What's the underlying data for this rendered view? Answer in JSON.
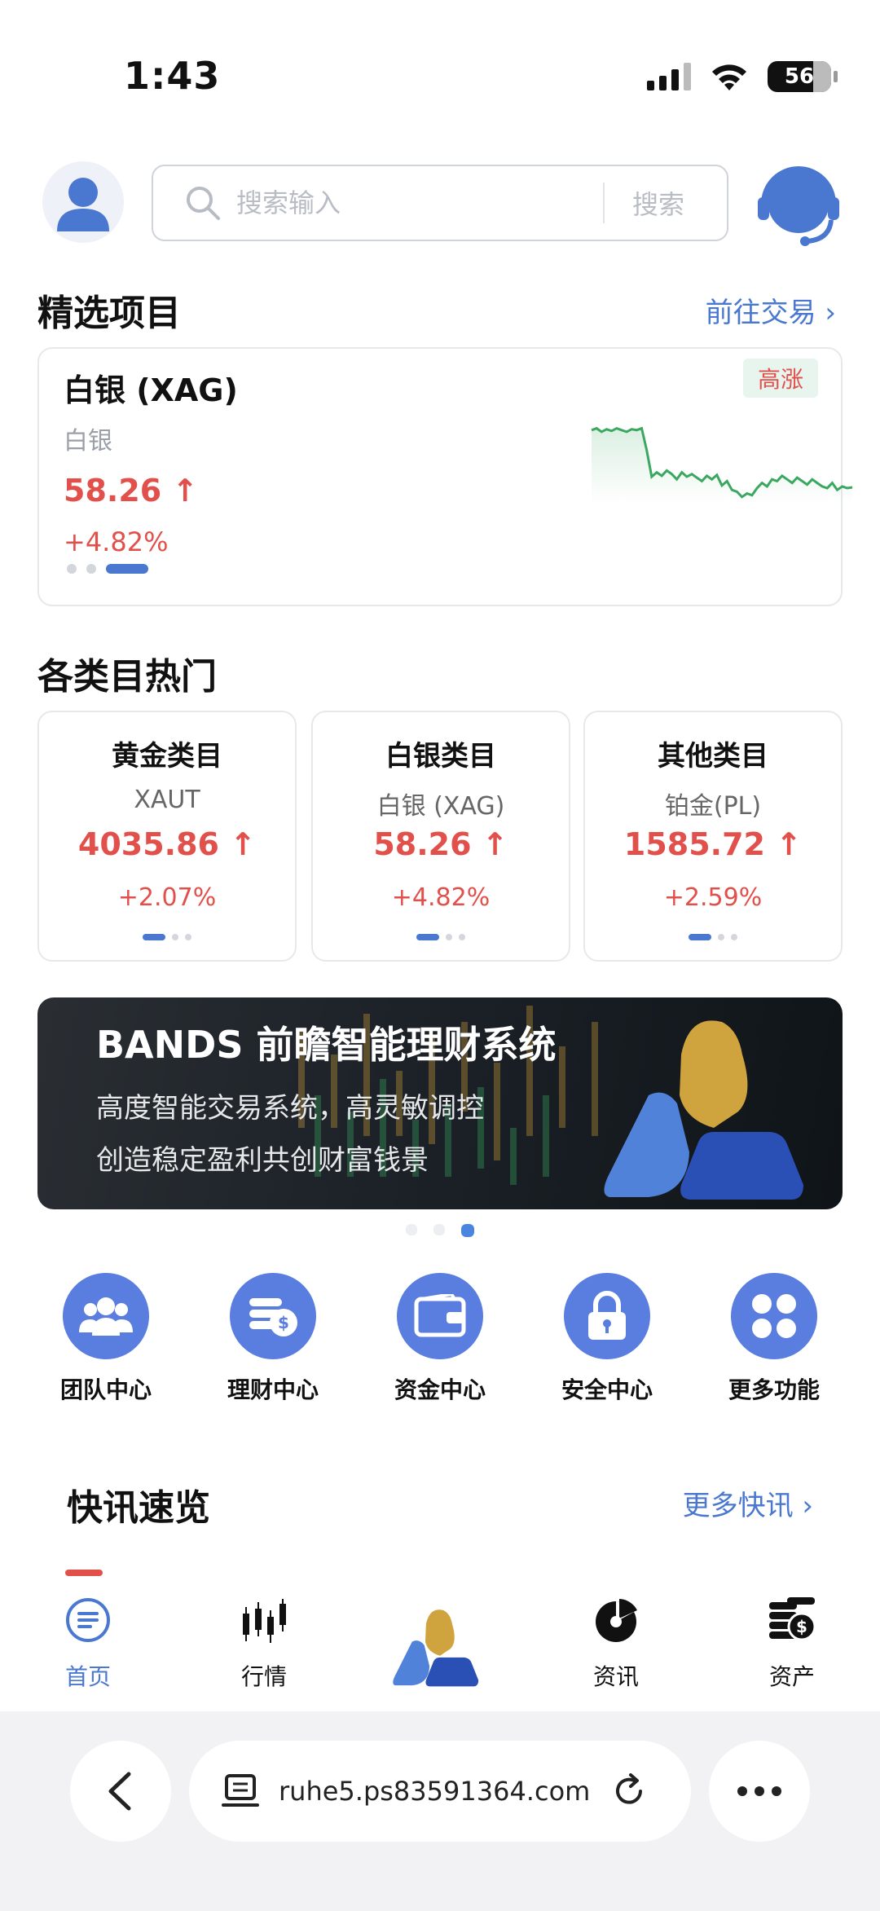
{
  "status_bar": {
    "time": "1:43",
    "battery": "56"
  },
  "header": {
    "search_placeholder": "搜索输入",
    "search_button": "搜索"
  },
  "featured": {
    "title": "精选项目",
    "link": "前往交易 ›",
    "name": "白银 (XAG)",
    "subtitle": "白银",
    "price": "58.26 ↑",
    "change": "+4.82%",
    "badge": "高涨",
    "sparkline": [
      0.78,
      0.8,
      0.76,
      0.79,
      0.77,
      0.8,
      0.78,
      0.76,
      0.79,
      0.78,
      0.8,
      0.55,
      0.25,
      0.3,
      0.26,
      0.32,
      0.28,
      0.22,
      0.3,
      0.25,
      0.28,
      0.24,
      0.2,
      0.26,
      0.22,
      0.27,
      0.15,
      0.2,
      0.1,
      0.08,
      0.02,
      0.06,
      0.04,
      0.12,
      0.18,
      0.14,
      0.22,
      0.2,
      0.26,
      0.22,
      0.18,
      0.24,
      0.2,
      0.16,
      0.22,
      0.18,
      0.14,
      0.12,
      0.18,
      0.1,
      0.14,
      0.12,
      0.13
    ]
  },
  "categories": {
    "title": "各类目热门",
    "items": [
      {
        "title": "黄金类目",
        "sub": "XAUT",
        "price": "4035.86 ↑",
        "change": "+2.07%"
      },
      {
        "title": "白银类目",
        "sub": "白银 (XAG)",
        "price": "58.26 ↑",
        "change": "+4.82%"
      },
      {
        "title": "其他类目",
        "sub": "铂金(PL)",
        "price": "1585.72 ↑",
        "change": "+2.59%"
      }
    ]
  },
  "banner": {
    "title": "BANDS 前瞻智能理财系统",
    "line1": "高度智能交易系统，高灵敏调控",
    "line2": "创造稳定盈利共创财富钱景"
  },
  "functions": [
    {
      "label": "团队中心",
      "icon": "team-icon"
    },
    {
      "label": "理财中心",
      "icon": "coins-icon"
    },
    {
      "label": "资金中心",
      "icon": "wallet-icon"
    },
    {
      "label": "安全中心",
      "icon": "lock-icon"
    },
    {
      "label": "更多功能",
      "icon": "grid-icon"
    }
  ],
  "news": {
    "title": "快讯速览",
    "link": "更多快讯 ›"
  },
  "tabbar": [
    {
      "label": "首页",
      "icon": "home-icon"
    },
    {
      "label": "行情",
      "icon": "candlestick-icon"
    },
    {
      "label": "",
      "icon": "logo-icon"
    },
    {
      "label": "资讯",
      "icon": "pie-icon"
    },
    {
      "label": "资产",
      "icon": "coin-stack-icon"
    }
  ],
  "browser": {
    "url": "ruhe5.ps83591364.com"
  },
  "colors": {
    "accent": "#4a78d0",
    "up": "#e2504c",
    "chart_green": "#3aa860"
  }
}
